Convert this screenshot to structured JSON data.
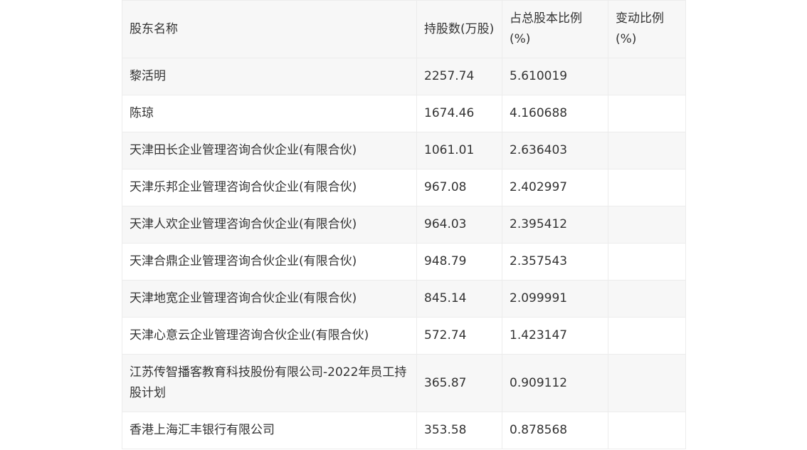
{
  "table": {
    "headers": [
      "股东名称",
      "持股数(万股)",
      "占总股本比例(%)",
      "变动比例(%)"
    ],
    "rows": [
      {
        "name": "黎活明",
        "shares": "2257.74",
        "ratio": "5.610019",
        "change": ""
      },
      {
        "name": "陈琼",
        "shares": "1674.46",
        "ratio": "4.160688",
        "change": ""
      },
      {
        "name": "天津田长企业管理咨询合伙企业(有限合伙)",
        "shares": "1061.01",
        "ratio": "2.636403",
        "change": ""
      },
      {
        "name": "天津乐邦企业管理咨询合伙企业(有限合伙)",
        "shares": "967.08",
        "ratio": "2.402997",
        "change": ""
      },
      {
        "name": "天津人欢企业管理咨询合伙企业(有限合伙)",
        "shares": "964.03",
        "ratio": "2.395412",
        "change": ""
      },
      {
        "name": "天津合鼎企业管理咨询合伙企业(有限合伙)",
        "shares": "948.79",
        "ratio": "2.357543",
        "change": ""
      },
      {
        "name": "天津地宽企业管理咨询合伙企业(有限合伙)",
        "shares": "845.14",
        "ratio": "2.099991",
        "change": ""
      },
      {
        "name": "天津心意云企业管理咨询合伙企业(有限合伙)",
        "shares": "572.74",
        "ratio": "1.423147",
        "change": ""
      },
      {
        "name": "江苏传智播客教育科技股份有限公司-2022年员工持股计划",
        "shares": "365.87",
        "ratio": "0.909112",
        "change": ""
      },
      {
        "name": "香港上海汇丰银行有限公司",
        "shares": "353.58",
        "ratio": "0.878568",
        "change": ""
      }
    ]
  }
}
